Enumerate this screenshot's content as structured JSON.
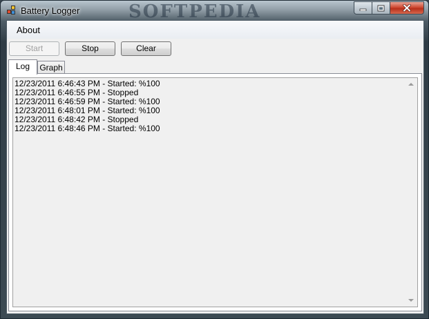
{
  "window": {
    "title": "Battery Logger",
    "watermark": "SOFTPEDIA"
  },
  "menu": {
    "items": [
      {
        "label": "About"
      }
    ]
  },
  "toolbar": {
    "start_label": "Start",
    "stop_label": "Stop",
    "clear_label": "Clear"
  },
  "tabs": [
    {
      "label": "Log",
      "selected": true
    },
    {
      "label": "Graph",
      "selected": false
    }
  ],
  "log": {
    "lines": [
      "12/23/2011 6:46:43 PM - Started: %100",
      "12/23/2011 6:46:55 PM - Stopped",
      "12/23/2011 6:46:59 PM - Started: %100",
      "12/23/2011 6:48:01 PM - Started: %100",
      "12/23/2011 6:48:42 PM - Stopped",
      "12/23/2011 6:48:46 PM - Started: %100"
    ]
  },
  "icons": {
    "app": "app-icon",
    "minimize": "minimize-icon",
    "maximize": "maximize-icon",
    "close": "close-icon",
    "scroll_up": "scroll-up-arrow-icon",
    "scroll_down": "scroll-down-arrow-icon"
  },
  "colors": {
    "close_button": "#c7412b",
    "panel": "#f0f0f0"
  }
}
